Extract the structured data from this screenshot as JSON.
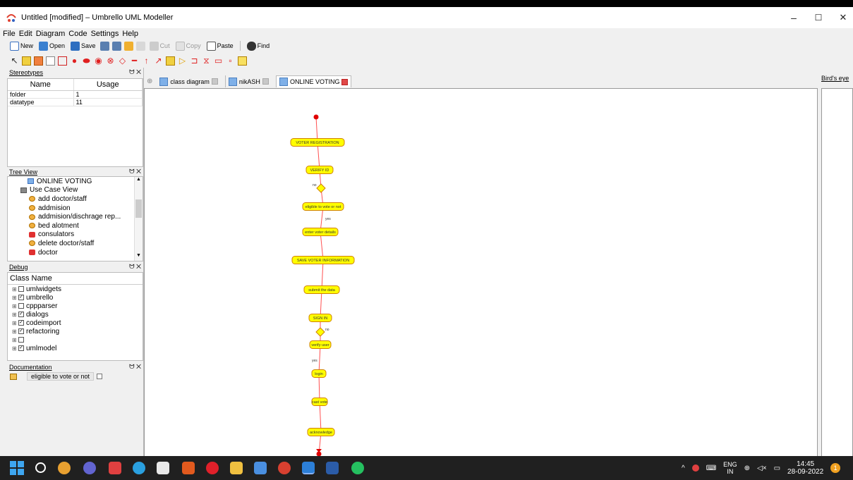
{
  "window": {
    "title": "Untitled [modified] – Umbrello UML Modeller",
    "minimize": "–",
    "maximize": "☐",
    "close": "✕"
  },
  "menu": [
    "File",
    "Edit",
    "Diagram",
    "Code",
    "Settings",
    "Help"
  ],
  "toolbar": {
    "new": "New",
    "open": "Open",
    "save": "Save",
    "cut": "Cut",
    "copy": "Copy",
    "paste": "Paste",
    "find": "Find"
  },
  "stereotypes": {
    "title": "Stereotypes",
    "columns": [
      "Name",
      "Usage"
    ],
    "rows": [
      {
        "name": "folder",
        "usage": "1"
      },
      {
        "name": "datatype",
        "usage": "11"
      }
    ]
  },
  "tree_view": {
    "title": "Tree View",
    "items": [
      {
        "label": "ONLINE VOTING",
        "icon": "diagram-icon"
      },
      {
        "label": "Use Case View",
        "icon": "folder-icon"
      },
      {
        "label": "add doctor/staff",
        "icon": "usecase-icon"
      },
      {
        "label": "addmision",
        "icon": "usecase-icon"
      },
      {
        "label": "addmision/dischrage rep...",
        "icon": "usecase-icon"
      },
      {
        "label": "bed alotment",
        "icon": "usecase-icon"
      },
      {
        "label": "consulators",
        "icon": "actor-icon"
      },
      {
        "label": "delete doctor/staff",
        "icon": "usecase-icon"
      },
      {
        "label": "doctor",
        "icon": "actor-icon"
      }
    ]
  },
  "debug": {
    "title": "Debug",
    "column": "Class Name",
    "items": [
      {
        "label": "umlwidgets",
        "checked": false
      },
      {
        "label": "umbrello",
        "checked": true
      },
      {
        "label": "cppparser",
        "checked": false
      },
      {
        "label": "dialogs",
        "checked": true
      },
      {
        "label": "codeimport",
        "checked": true
      },
      {
        "label": "refactoring",
        "checked": true
      },
      {
        "label": "",
        "checked": false
      },
      {
        "label": "umlmodel",
        "checked": true
      }
    ]
  },
  "documentation": {
    "title": "Documentation",
    "value": "eligible to vote or not"
  },
  "tabs": [
    {
      "label": "class diagram",
      "active": false
    },
    {
      "label": "nikASH",
      "active": false
    },
    {
      "label": "ONLINE VOTING",
      "active": true
    }
  ],
  "birds_eye": {
    "title": "Bird's eye"
  },
  "diagram": {
    "nodes": [
      "VOTER REGISTRATION",
      "VERIFY ID",
      "eligible to vote or not",
      "enter voter details",
      "SAVE VOTER INFORMATION",
      "submit the data",
      "SIGN IN",
      "verify user",
      "login",
      "cast vote",
      "acknowledge"
    ],
    "labels": {
      "no1": "no",
      "yes1": "yes",
      "no2": "no",
      "yes2": "yes"
    }
  },
  "taskbar": {
    "lang": "ENG",
    "region": "IN",
    "time": "14:45",
    "date": "28-09-2022",
    "notifications": "1"
  },
  "colors": {
    "node_fill": "#ffff00",
    "node_border": "#d08000",
    "edge": "#ff5050",
    "start": "#e00000"
  }
}
